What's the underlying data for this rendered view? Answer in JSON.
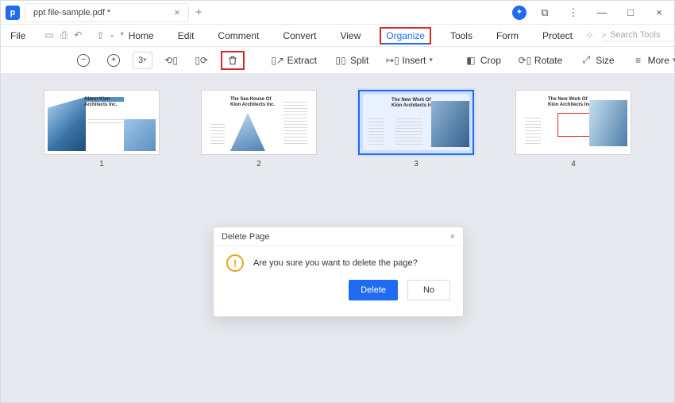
{
  "titlebar": {
    "tab_title": "ppt file-sample.pdf *"
  },
  "menubar": {
    "file": "File",
    "items": [
      "Home",
      "Edit",
      "Comment",
      "Convert",
      "View",
      "Organize",
      "Tools",
      "Form",
      "Protect"
    ],
    "active_index": 5,
    "search_placeholder": "Search Tools"
  },
  "toolbar": {
    "page_value": "3",
    "extract": "Extract",
    "split": "Split",
    "insert": "Insert",
    "crop": "Crop",
    "rotate": "Rotate",
    "size": "Size",
    "more": "More"
  },
  "thumbs": [
    {
      "num": "1",
      "title": "About Klon Architects Inc."
    },
    {
      "num": "2",
      "title": "The Sea House Of Klon Architects Inc."
    },
    {
      "num": "3",
      "title": "The New Work Of Klon Architects Inc."
    },
    {
      "num": "4",
      "title": "The New Work Of Klon Architects Inc."
    }
  ],
  "selected_thumb_index": 2,
  "dialog": {
    "title": "Delete Page",
    "message": "Are you sure you want to delete the page?",
    "delete": "Delete",
    "no": "No"
  }
}
